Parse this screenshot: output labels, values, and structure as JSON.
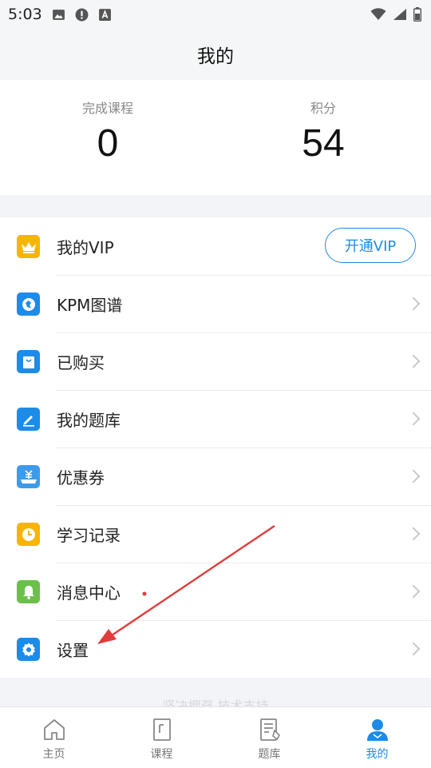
{
  "status_bar": {
    "time": "5:03",
    "icons": [
      "image-icon",
      "alert-icon",
      "font-icon"
    ],
    "right_icons": [
      "wifi-icon",
      "signal-icon",
      "battery-icon"
    ]
  },
  "header": {
    "title": "我的"
  },
  "stats": [
    {
      "label": "完成课程",
      "value": "0"
    },
    {
      "label": "积分",
      "value": "54"
    }
  ],
  "menu": {
    "vip_button": "开通VIP",
    "items": [
      {
        "label": "我的VIP",
        "icon": "crown-icon",
        "color": "#f7b500"
      },
      {
        "label": "KPM图谱",
        "icon": "globe-icon",
        "color": "#1d8be8"
      },
      {
        "label": "已购买",
        "icon": "shopping-bag-icon",
        "color": "#1d8be8"
      },
      {
        "label": "我的题库",
        "icon": "pencil-icon",
        "color": "#1d8be8"
      },
      {
        "label": "优惠券",
        "icon": "yuan-coupon-icon",
        "color": "#3d9be9"
      },
      {
        "label": "学习记录",
        "icon": "clock-icon",
        "color": "#f7b500"
      },
      {
        "label": "消息中心",
        "icon": "bell-icon",
        "color": "#6cc04a"
      },
      {
        "label": "设置",
        "icon": "gear-icon",
        "color": "#1d8be8"
      }
    ]
  },
  "footer_text": "坚决拥趸 技术支持",
  "bottom_nav": [
    {
      "label": "主页",
      "icon": "home-icon",
      "active": false
    },
    {
      "label": "课程",
      "icon": "book-icon",
      "active": false
    },
    {
      "label": "题库",
      "icon": "question-bank-icon",
      "active": false
    },
    {
      "label": "我的",
      "icon": "profile-icon",
      "active": true
    }
  ],
  "colors": {
    "accent": "#1d8be8",
    "annotation": "#e03c3c"
  }
}
